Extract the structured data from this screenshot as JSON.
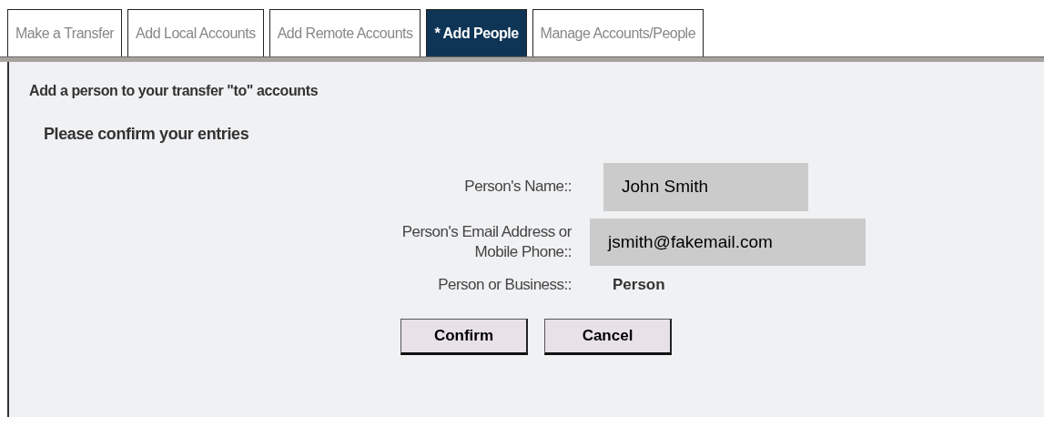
{
  "tabs": [
    {
      "label": "Make a Transfer",
      "selected": false
    },
    {
      "label": "Add Local Accounts",
      "selected": false
    },
    {
      "label": "Add Remote Accounts",
      "selected": false
    },
    {
      "label": "* Add People",
      "selected": true
    },
    {
      "label": "Manage Accounts/People",
      "selected": false
    }
  ],
  "heading": "Add a person to your transfer \"to\" accounts",
  "subheading": "Please confirm your entries",
  "fields": [
    {
      "kind": "field",
      "label": "Person's Name::",
      "value": "John Smith"
    },
    {
      "kind": "field",
      "label": "Person's Email Address or Mobile Phone::",
      "value": "jsmith@fakemail.com"
    },
    {
      "kind": "text",
      "label": "Person or Business::",
      "value": "Person"
    }
  ],
  "buttons": [
    "Confirm",
    "Cancel"
  ]
}
